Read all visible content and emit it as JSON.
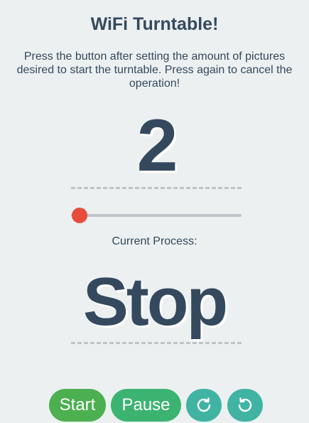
{
  "header": {
    "title": "WiFi Turntable!",
    "instructions": "Press the button after setting the amount of pictures desired to start the turntable. Press again to cancel the operation!"
  },
  "counter": {
    "value": "2"
  },
  "slider": {
    "fraction": 0.05,
    "thumb_color": "#e74c3c",
    "track_color": "#bdc3c7"
  },
  "process": {
    "label": "Current Process:",
    "status": "Stop"
  },
  "controls": {
    "start_label": "Start",
    "pause_label": "Pause",
    "rotate_cw_icon": "rotate-clockwise-icon",
    "rotate_ccw_icon": "rotate-counterclockwise-icon"
  },
  "colors": {
    "background": "#ecf0f1",
    "text": "#34495e",
    "start": "#4caf50",
    "pause": "#3cb371",
    "rotate": "#41b3a3"
  }
}
